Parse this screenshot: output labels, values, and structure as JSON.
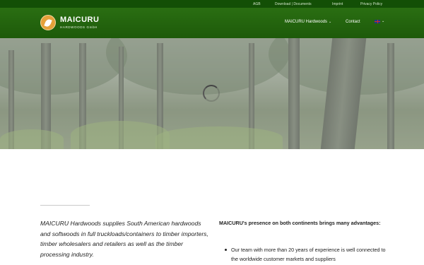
{
  "topbar": {
    "links": [
      "AGB",
      "Download | Documents",
      "Imprint",
      "Privacy Policy"
    ]
  },
  "header": {
    "brand": "MAICURU",
    "brand_sub": "HARDWOODS GmbH",
    "nav": {
      "hardwoods": "MAICURU Hardwoods",
      "contact": "Contact"
    }
  },
  "hero": {
    "loading": true
  },
  "content": {
    "intro": "MAICURU Hardwoods supplies South American hardwoods and softwoods in full truckloads/containers to timber importers, timber wholesalers and retailers as well as the timber processing industry.",
    "advantages_title": "MAICURU's presence on both continents brings many advantages:",
    "advantages": [
      "Our team with more than 20 years of experience is well connected to the worldwide customer markets and suppliers"
    ]
  },
  "icons": {
    "logo": "leaf-logo-icon",
    "chevron": "chevron-down-icon",
    "language": "uk-flag-icon",
    "loading": "spinner-icon"
  },
  "colors": {
    "header": "#2a6e12",
    "topbar": "#134f06",
    "logo": "#e5a13a"
  }
}
